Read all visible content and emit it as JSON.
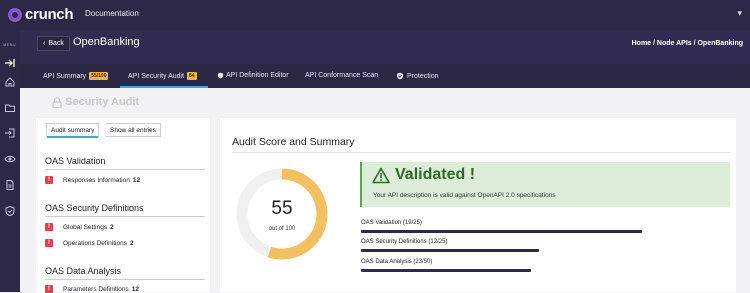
{
  "app": {
    "logo_text": "crunch",
    "doc_link": "Documentation"
  },
  "sidebar": {
    "label": "MENU",
    "icons": [
      "collapse-icon",
      "home-icon",
      "folder-icon",
      "import-icon",
      "eye-icon",
      "document-icon",
      "shield-icon"
    ]
  },
  "header": {
    "back_label": "Back",
    "title": "OpenBanking",
    "breadcrumb": "Home / Node APIs / OpenBanking"
  },
  "tabs": [
    {
      "label": "API Summary",
      "badge": "55/100"
    },
    {
      "label": "API Security Audit",
      "badge": "84"
    },
    {
      "label": "API Definition Editor"
    },
    {
      "label": "API Conformance Scan"
    },
    {
      "label": "Protection"
    }
  ],
  "audit": {
    "title": "Security Audit"
  },
  "left_panel": {
    "subtabs": [
      "Audit summary",
      "Show all entries"
    ],
    "sections": [
      {
        "title": "OAS Validation",
        "items": [
          {
            "label": "Responses Information",
            "count": "12"
          }
        ]
      },
      {
        "title": "OAS Security Definitions",
        "items": [
          {
            "label": "Global Settings",
            "count": "2"
          },
          {
            "label": "Operations Definitions",
            "count": "2"
          }
        ]
      },
      {
        "title": "OAS Data Analysis",
        "items": [
          {
            "label": "Parameters Definitions",
            "count": "12"
          }
        ]
      }
    ]
  },
  "summary": {
    "title": "Audit Score and Summary",
    "score": "55",
    "score_label": "out of 100",
    "score_fraction": 0.55,
    "validated_title": "Validated !",
    "validated_msg": "Your API description is valid against OpenAPI 2.0 specifications",
    "metrics": [
      {
        "label": "OAS Validation (19/25)",
        "fraction": 0.76
      },
      {
        "label": "OAS Security Definitions (12/25)",
        "fraction": 0.48
      },
      {
        "label": "OAS Data Analysis (23/50)",
        "fraction": 0.46
      }
    ]
  },
  "colors": {
    "nav": "#2d2848",
    "accent": "#3fa8e0",
    "gauge": "#f2c062",
    "success": "#2d6b2a",
    "error": "#d94452"
  }
}
